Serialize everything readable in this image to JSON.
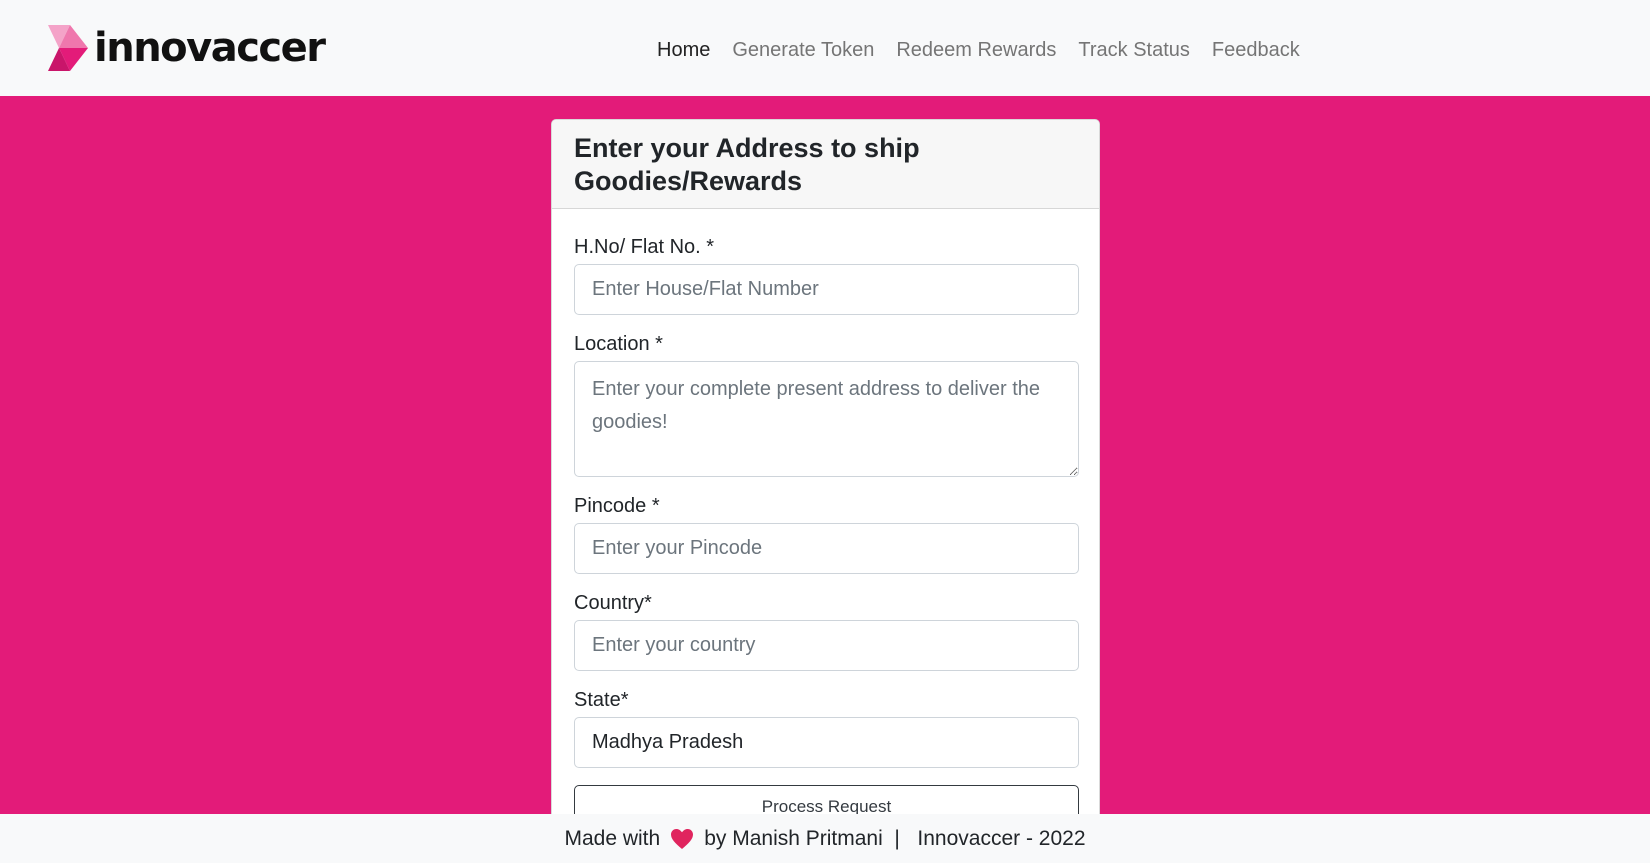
{
  "brand": {
    "name": "innovaccer",
    "colors": {
      "primary": "#e31b79",
      "logo_light": "#f4a3c8",
      "logo_dark": "#e31b79"
    }
  },
  "nav": {
    "items": [
      {
        "label": "Home",
        "active": true
      },
      {
        "label": "Generate Token",
        "active": false
      },
      {
        "label": "Redeem Rewards",
        "active": false
      },
      {
        "label": "Track Status",
        "active": false
      },
      {
        "label": "Feedback",
        "active": false
      }
    ]
  },
  "form": {
    "title": "Enter your Address to ship Goodies/Rewards",
    "fields": {
      "house": {
        "label": "H.No/ Flat No. *",
        "placeholder": "Enter House/Flat Number",
        "value": ""
      },
      "location": {
        "label": "Location *",
        "placeholder": "Enter your complete present address to deliver the goodies!",
        "value": ""
      },
      "pincode": {
        "label": "Pincode *",
        "placeholder": "Enter your Pincode",
        "value": ""
      },
      "country": {
        "label": "Country*",
        "placeholder": "Enter your country",
        "value": ""
      },
      "state": {
        "label": "State*",
        "placeholder": "",
        "value": "Madhya Pradesh"
      }
    },
    "submit_label": "Process Request"
  },
  "footer": {
    "prefix": "Made with",
    "heart_icon": "heart-icon",
    "suffix": "by Manish Pritmani  |   Innovaccer - 2022"
  }
}
